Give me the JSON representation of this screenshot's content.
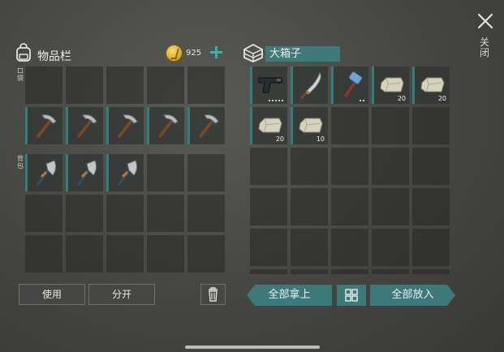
{
  "header": {
    "close_label": "关闭"
  },
  "inventory": {
    "title": "物品栏",
    "coins": "925",
    "pocket_label": "口袋",
    "backpack_label": "背包",
    "pocket_slots": [
      {
        "item": "",
        "qty": ""
      },
      {
        "item": "",
        "qty": ""
      },
      {
        "item": "",
        "qty": ""
      },
      {
        "item": "",
        "qty": ""
      },
      {
        "item": "",
        "qty": ""
      },
      {
        "item": "pickaxe-icon",
        "qty": ""
      },
      {
        "item": "pickaxe-icon",
        "qty": ""
      },
      {
        "item": "pickaxe-icon",
        "qty": ""
      },
      {
        "item": "pickaxe-icon",
        "qty": ""
      },
      {
        "item": "pickaxe-icon",
        "qty": ""
      }
    ],
    "backpack_slots": [
      {
        "item": "axe-icon",
        "qty": ""
      },
      {
        "item": "axe-icon",
        "qty": ""
      },
      {
        "item": "axe-icon",
        "qty": ""
      },
      {
        "item": "",
        "qty": ""
      },
      {
        "item": "",
        "qty": ""
      },
      {
        "item": "",
        "qty": ""
      },
      {
        "item": "",
        "qty": ""
      },
      {
        "item": "",
        "qty": ""
      },
      {
        "item": "",
        "qty": ""
      },
      {
        "item": "",
        "qty": ""
      },
      {
        "item": "",
        "qty": ""
      },
      {
        "item": "",
        "qty": ""
      },
      {
        "item": "",
        "qty": ""
      },
      {
        "item": "",
        "qty": ""
      },
      {
        "item": "",
        "qty": ""
      }
    ],
    "use_label": "使用",
    "split_label": "分开"
  },
  "chest": {
    "title": "大箱子",
    "take_all_label": "全部拿上",
    "put_all_label": "全部放入",
    "slots": [
      {
        "item": "pistol-icon",
        "qty": "",
        "dots": 5
      },
      {
        "item": "machete-icon",
        "qty": "",
        "dots": 0
      },
      {
        "item": "hammer-icon",
        "qty": "",
        "dots": 2
      },
      {
        "item": "stone-icon",
        "qty": "20",
        "dots": 0
      },
      {
        "item": "stone-icon",
        "qty": "20",
        "dots": 0
      },
      {
        "item": "stone-icon",
        "qty": "20",
        "dots": 0
      },
      {
        "item": "stone-icon",
        "qty": "10",
        "dots": 0
      },
      {
        "item": "",
        "qty": "",
        "dots": 0
      },
      {
        "item": "",
        "qty": "",
        "dots": 0
      },
      {
        "item": "",
        "qty": "",
        "dots": 0
      },
      {
        "item": "",
        "qty": "",
        "dots": 0
      },
      {
        "item": "",
        "qty": "",
        "dots": 0
      },
      {
        "item": "",
        "qty": "",
        "dots": 0
      },
      {
        "item": "",
        "qty": "",
        "dots": 0
      },
      {
        "item": "",
        "qty": "",
        "dots": 0
      },
      {
        "item": "",
        "qty": "",
        "dots": 0
      },
      {
        "item": "",
        "qty": "",
        "dots": 0
      },
      {
        "item": "",
        "qty": "",
        "dots": 0
      },
      {
        "item": "",
        "qty": "",
        "dots": 0
      },
      {
        "item": "",
        "qty": "",
        "dots": 0
      },
      {
        "item": "",
        "qty": "",
        "dots": 0
      },
      {
        "item": "",
        "qty": "",
        "dots": 0
      },
      {
        "item": "",
        "qty": "",
        "dots": 0
      },
      {
        "item": "",
        "qty": "",
        "dots": 0
      },
      {
        "item": "",
        "qty": "",
        "dots": 0
      },
      {
        "item": "",
        "qty": "",
        "dots": 0
      },
      {
        "item": "",
        "qty": "",
        "dots": 0
      },
      {
        "item": "",
        "qty": "",
        "dots": 0
      },
      {
        "item": "",
        "qty": "",
        "dots": 0
      },
      {
        "item": "",
        "qty": "",
        "dots": 0
      }
    ]
  },
  "colors": {
    "accent": "#2f7f7c",
    "coin": "#d9a41f",
    "plus": "#2fb4b0"
  }
}
